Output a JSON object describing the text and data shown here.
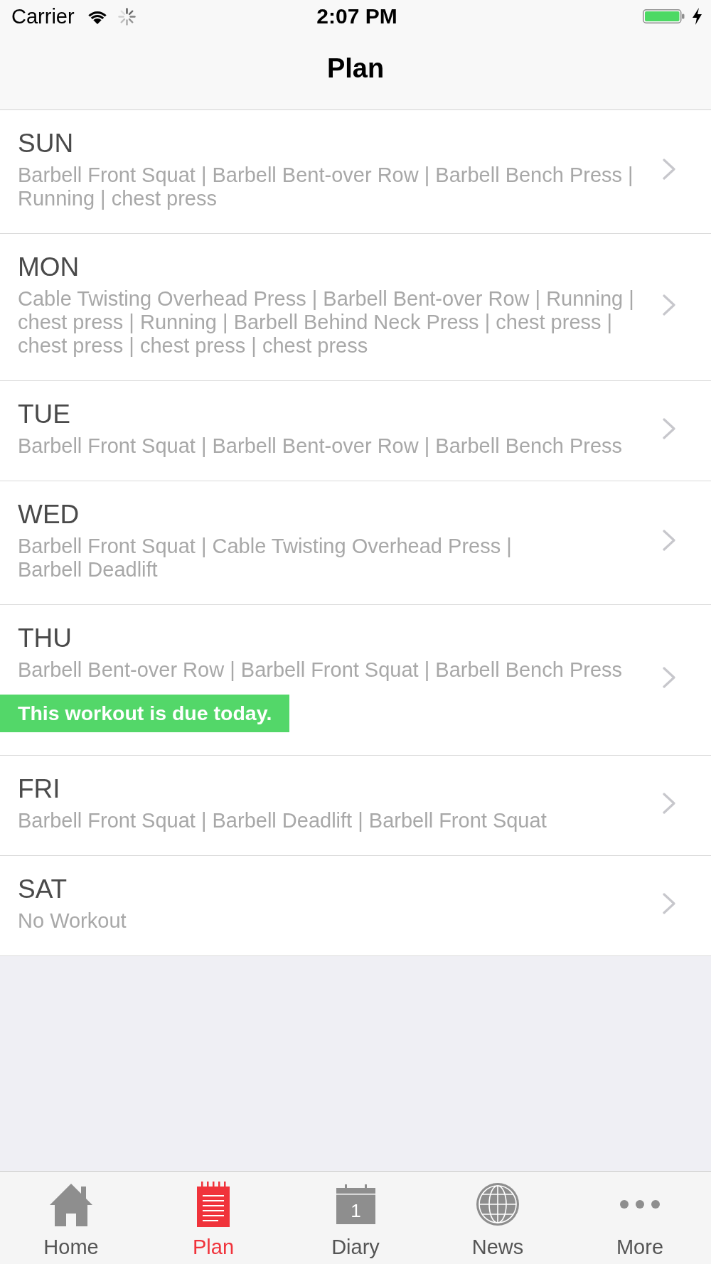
{
  "status_bar": {
    "carrier": "Carrier",
    "time": "2:07 PM"
  },
  "nav_bar": {
    "title": "Plan"
  },
  "days": [
    {
      "day": "SUN",
      "exercises": "Barbell Front Squat | Barbell Bent-over Row | Barbell Bench Press | Running | chest press"
    },
    {
      "day": "MON",
      "exercises": "Cable Twisting Overhead Press | Barbell Bent-over Row | Running | chest press | Running | Barbell Behind Neck Press | chest press | chest press | chest press | chest press"
    },
    {
      "day": "TUE",
      "exercises": "Barbell Front Squat | Barbell Bent-over Row | Barbell Bench Press"
    },
    {
      "day": "WED",
      "exercises": "Barbell Front Squat | Cable Twisting Overhead Press | Barbell Deadlift"
    },
    {
      "day": "THU",
      "exercises": "Barbell Bent-over Row | Barbell Front Squat | Barbell Bench Press",
      "due_banner": "This workout is due today."
    },
    {
      "day": "FRI",
      "exercises": "Barbell Front Squat | Barbell Deadlift | Barbell Front Squat"
    },
    {
      "day": "SAT",
      "exercises": "No Workout"
    }
  ],
  "tab_bar": {
    "tabs": [
      {
        "kind": "home",
        "label": "Home",
        "selected": false
      },
      {
        "kind": "notepad",
        "label": "Plan",
        "selected": true
      },
      {
        "kind": "calendar",
        "label": "Diary",
        "icon_text": "1",
        "selected": false
      },
      {
        "kind": "globe",
        "label": "News",
        "selected": false
      },
      {
        "kind": "more",
        "label": "More",
        "selected": false
      }
    ]
  }
}
